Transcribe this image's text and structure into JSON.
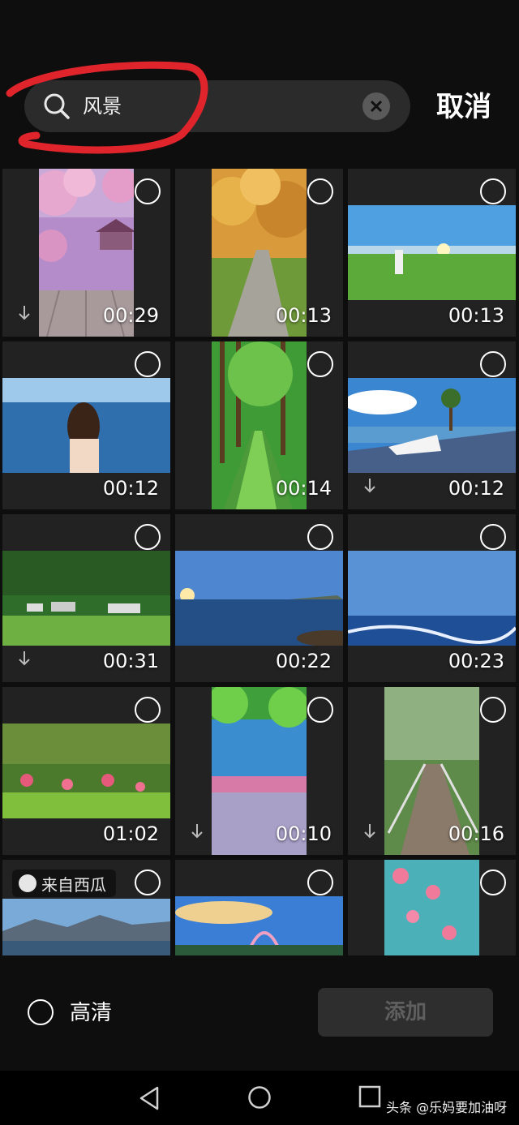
{
  "search": {
    "query": "风景",
    "icon": "search-icon",
    "clear_icon": "close-icon"
  },
  "cancel_label": "取消",
  "videos": [
    {
      "duration": "00:29",
      "scene": "cherry-blossom-pavilion",
      "download": true
    },
    {
      "duration": "00:13",
      "scene": "autumn-path"
    },
    {
      "duration": "00:13",
      "scene": "meadow-sunrise"
    },
    {
      "duration": "00:12",
      "scene": "woman-by-sea"
    },
    {
      "duration": "00:14",
      "scene": "forest-walkway"
    },
    {
      "duration": "00:12",
      "scene": "lakeside-dress",
      "download": true
    },
    {
      "duration": "00:31",
      "scene": "village-hills",
      "download": true
    },
    {
      "duration": "00:22",
      "scene": "sea-sunset-birds"
    },
    {
      "duration": "00:23",
      "scene": "seagulls-ocean"
    },
    {
      "duration": "01:02",
      "scene": "pond-flowers"
    },
    {
      "duration": "00:10",
      "scene": "willow-flowers",
      "download": true
    },
    {
      "duration": "00:16",
      "scene": "wooden-bridge",
      "download": true
    },
    {
      "duration": "",
      "scene": "mountain-lake",
      "source_badge": "来自西瓜"
    },
    {
      "duration": "",
      "scene": "rainbow-sky"
    },
    {
      "duration": "",
      "scene": "pink-blossoms"
    }
  ],
  "hd_label": "高清",
  "add_label": "添加",
  "watermark": "头条 @乐妈要加油呀",
  "colors": {
    "background": "#0e0e0e",
    "tile": "#222222",
    "annotation": "#e0242b"
  }
}
